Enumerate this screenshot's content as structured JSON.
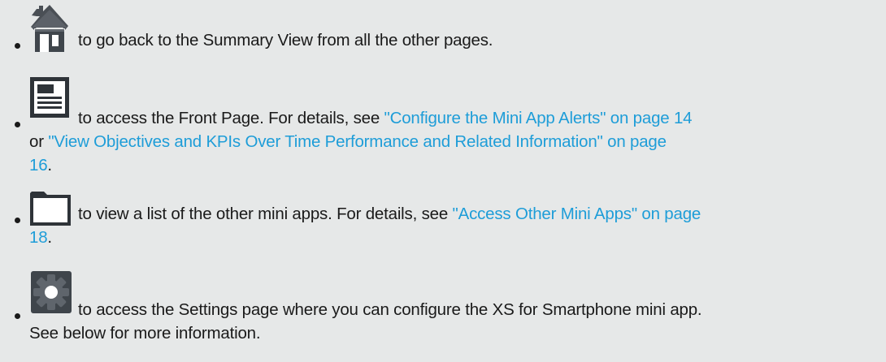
{
  "items": [
    {
      "icon": "home-icon",
      "text": "to go back to the Summary View from all the other pages."
    },
    {
      "icon": "front-page-icon",
      "text1": "to access the Front Page. For details, see ",
      "link1": "\"Configure the Mini App Alerts\" on page 14",
      "text2": "or ",
      "link2": "\"View Objectives and KPIs Over Time Performance and Related Information\" on page",
      "link2_cont": "16",
      "text3": "."
    },
    {
      "icon": "folder-icon",
      "text1": "to view a list of the other mini apps. For details, see ",
      "link1": "\"Access Other Mini Apps\" on page",
      "link1_cont": "18",
      "text2": "."
    },
    {
      "icon": "settings-gear-icon",
      "text1": "to access the Settings page where you can configure the XS for Smartphone mini app.",
      "text2": "See below for more information."
    }
  ],
  "colors": {
    "background": "#e6e8e8",
    "text": "#1a1a1a",
    "link": "#1e9dd8"
  }
}
